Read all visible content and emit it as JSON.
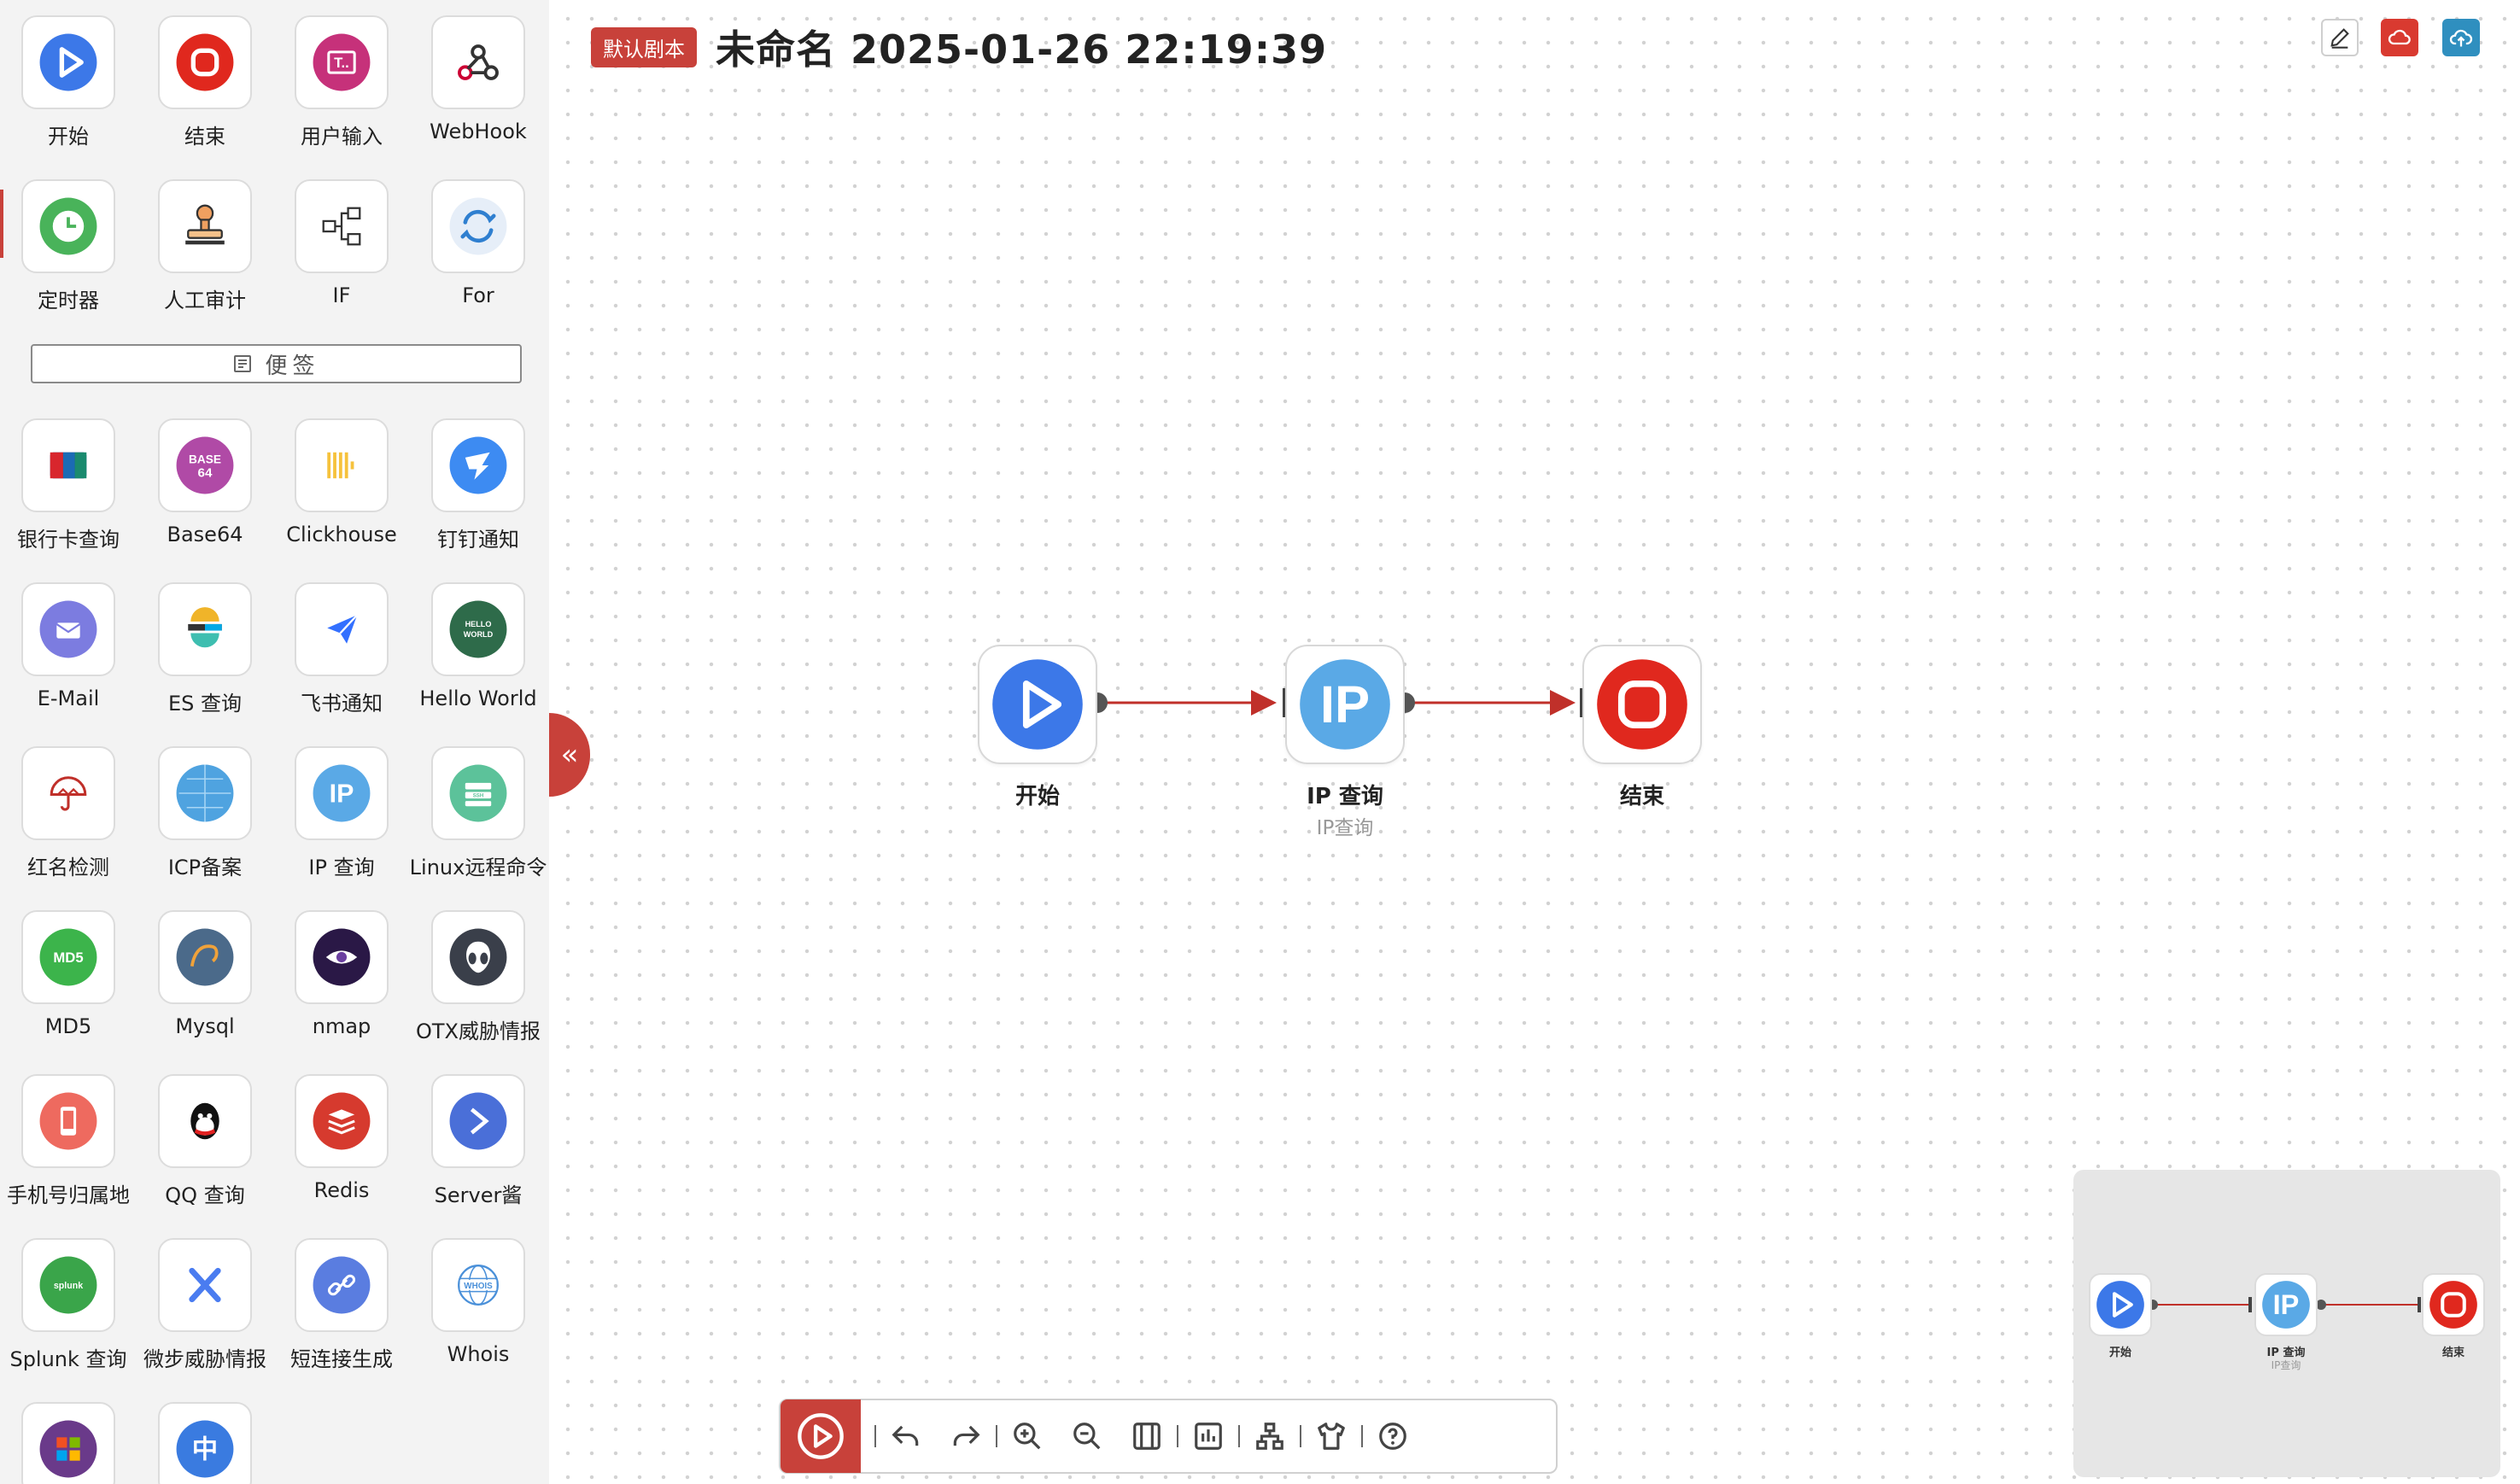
{
  "sidebar": {
    "tools": [
      {
        "label": "开始",
        "icon": "start-play-icon"
      },
      {
        "label": "结束",
        "icon": "end-stop-icon"
      },
      {
        "label": "用户输入",
        "icon": "user-input-icon"
      },
      {
        "label": "WebHook",
        "icon": "webhook-icon"
      },
      {
        "label": "定时器",
        "icon": "timer-clock-icon"
      },
      {
        "label": "人工审计",
        "icon": "manual-audit-stamp-icon"
      },
      {
        "label": "IF",
        "icon": "if-branch-icon"
      },
      {
        "label": "For",
        "icon": "for-loop-icon"
      }
    ],
    "memo_label": "便签",
    "apps": [
      {
        "label": "银行卡查询",
        "icon": "bank-card-icon"
      },
      {
        "label": "Base64",
        "icon": "base64-icon",
        "text": "BASE 64"
      },
      {
        "label": "Clickhouse",
        "icon": "clickhouse-icon"
      },
      {
        "label": "钉钉通知",
        "icon": "dingtalk-icon"
      },
      {
        "label": "E-Mail",
        "icon": "email-icon"
      },
      {
        "label": "ES 查询",
        "icon": "elasticsearch-icon"
      },
      {
        "label": "飞书通知",
        "icon": "feishu-icon"
      },
      {
        "label": "Hello World",
        "icon": "hello-world-icon",
        "text": "HELLO WORLD"
      },
      {
        "label": "红名检测",
        "icon": "umbrella-icon"
      },
      {
        "label": "ICP备案",
        "icon": "globe-icon"
      },
      {
        "label": "IP 查询",
        "icon": "ip-icon",
        "text": "IP"
      },
      {
        "label": "Linux远程命令",
        "icon": "linux-ssh-icon",
        "text": "SSH"
      },
      {
        "label": "MD5",
        "icon": "md5-icon",
        "text": "MD5"
      },
      {
        "label": "Mysql",
        "icon": "mysql-icon"
      },
      {
        "label": "nmap",
        "icon": "nmap-eye-icon"
      },
      {
        "label": "OTX威胁情报",
        "icon": "otx-alien-icon"
      },
      {
        "label": "手机号归属地",
        "icon": "phone-icon"
      },
      {
        "label": "QQ 查询",
        "icon": "qq-penguin-icon"
      },
      {
        "label": "Redis",
        "icon": "redis-icon"
      },
      {
        "label": "Server酱",
        "icon": "server-chan-icon"
      },
      {
        "label": "Splunk 查询",
        "icon": "splunk-icon",
        "text": "splunk"
      },
      {
        "label": "微步威胁情报",
        "icon": "threatbook-x-icon"
      },
      {
        "label": "短连接生成",
        "icon": "short-link-icon"
      },
      {
        "label": "Whois",
        "icon": "whois-globe-icon",
        "text": "WHOIS"
      },
      {
        "label": "",
        "icon": "windows-icon"
      },
      {
        "label": "",
        "icon": "chinese-char-icon",
        "text": "中"
      }
    ]
  },
  "header": {
    "badge": "默认剧本",
    "title": "未命名 2025-01-26 22:19:39"
  },
  "flow": {
    "nodes": [
      {
        "label": "开始",
        "subtitle": "",
        "icon": "start-play-icon"
      },
      {
        "label": "IP 查询",
        "subtitle": "IP查询",
        "icon": "ip-icon"
      },
      {
        "label": "结束",
        "subtitle": "",
        "icon": "end-stop-icon"
      }
    ]
  },
  "colors": {
    "accent": "#c8413a",
    "edge": "#c0302a",
    "start_blue": "#3c78e8",
    "ip_blue": "#5aa9e6",
    "end_red": "#e0281e"
  },
  "toolbar": {
    "items": [
      "run-icon",
      "undo-icon",
      "redo-icon",
      "zoom-in-icon",
      "zoom-out-icon",
      "fit-view-icon",
      "minimap-toggle-icon",
      "auto-layout-icon",
      "theme-shirt-icon",
      "help-icon"
    ]
  }
}
